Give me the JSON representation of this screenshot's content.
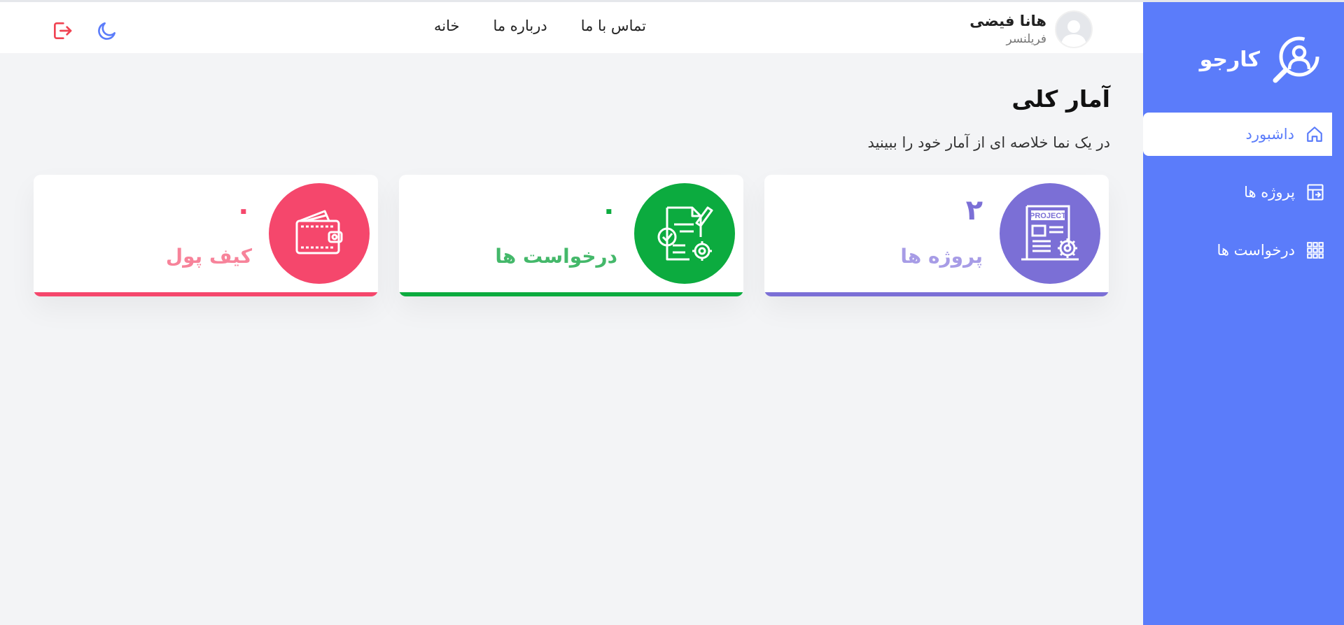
{
  "brand": {
    "name": "کارجو"
  },
  "sidebar": {
    "items": [
      {
        "label": "داشبورد",
        "icon": "home-icon",
        "active": true
      },
      {
        "label": "پروژه ها",
        "icon": "projects-icon",
        "active": false
      },
      {
        "label": "درخواست ها",
        "icon": "grid-icon",
        "active": false
      }
    ]
  },
  "header": {
    "user_name": "هانا فیضی",
    "user_role": "فریلنسر",
    "nav": [
      "خانه",
      "درباره ما",
      "تماس با ما"
    ],
    "icons": [
      "moon-icon",
      "logout-icon"
    ]
  },
  "main": {
    "title": "آمار کلی",
    "subtitle": "در یک نما خلاصه ای از آمار خود را ببینید",
    "cards": [
      {
        "title": "پروژه ها",
        "count": "۲",
        "icon": "project-doc-icon",
        "color": "#7b6fd6",
        "title_color": "#a79ce6"
      },
      {
        "title": "درخواست ها",
        "count": "۰",
        "icon": "request-doc-icon",
        "color": "#0cab3f",
        "title_color": "#44b86a"
      },
      {
        "title": "کیف پول",
        "count": "۰",
        "icon": "wallet-icon",
        "color": "#f5476c",
        "title_color": "#f7839a"
      }
    ]
  },
  "colors": {
    "primary": "#5b7cfa",
    "background": "#f3f4f6",
    "logout": "#f04352"
  }
}
